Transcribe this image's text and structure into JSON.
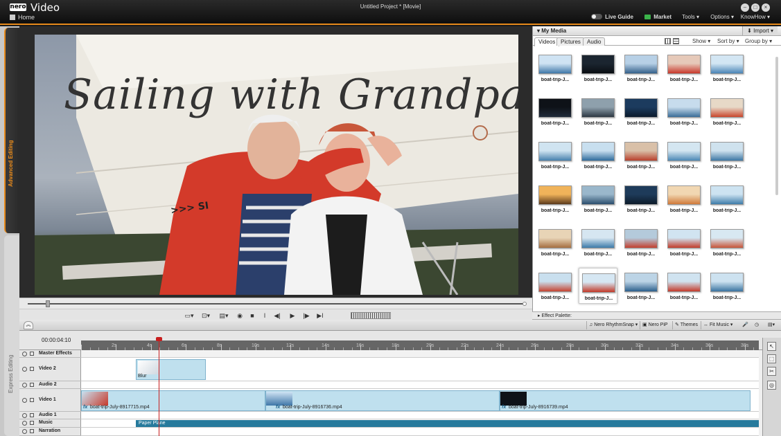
{
  "app": {
    "logo": "nero",
    "name": "Video",
    "window_title": "Untitled Project * [Movie]",
    "home": "Home"
  },
  "menu": {
    "live_guide": "Live Guide",
    "market": "Market",
    "tools": "Tools ▾",
    "options": "Options ▾",
    "knowhow": "KnowHow ▾"
  },
  "side_tabs": {
    "advanced": "Advanced Editing",
    "express": "Express Editing"
  },
  "preview": {
    "title_overlay": "Sailing with Grandpa",
    "sail_text": ">>> SI"
  },
  "media": {
    "header": "▾ My Media",
    "import": "⬇ Import ▾",
    "tabs": [
      "Videos",
      "Pictures",
      "Audio"
    ],
    "show": "Show ▾",
    "sort_by": "Sort by ▾",
    "group_by": "Group by ▾",
    "thumb_label": "boat-trip-J...",
    "thumbs": [
      {
        "c1": "#cfe3f3",
        "c2": "#3f77a8"
      },
      {
        "c1": "#1b2530",
        "c2": "#0a0e12"
      },
      {
        "c1": "#b7d0e6",
        "c2": "#34608a"
      },
      {
        "c1": "#e6c9b9",
        "c2": "#c8382b"
      },
      {
        "c1": "#d3e6f3",
        "c2": "#4a84b6"
      },
      {
        "c1": "#0e1218",
        "c2": "#1f2a3a"
      },
      {
        "c1": "#8ea0ac",
        "c2": "#2d3842"
      },
      {
        "c1": "#1c3b5e",
        "c2": "#0b1a2c"
      },
      {
        "c1": "#c7dced",
        "c2": "#3a6d98"
      },
      {
        "c1": "#e7d9c7",
        "c2": "#c9462c"
      },
      {
        "c1": "#d0e4f1",
        "c2": "#4780ad"
      },
      {
        "c1": "#c8dfef",
        "c2": "#2f6b9c"
      },
      {
        "c1": "#d9c0a8",
        "c2": "#b8402c"
      },
      {
        "c1": "#d4e6f1",
        "c2": "#4c88b5"
      },
      {
        "c1": "#cfe2ee",
        "c2": "#3d77a4"
      },
      {
        "c1": "#f0b35a",
        "c2": "#5b3a1c"
      },
      {
        "c1": "#9ab7cb",
        "c2": "#2b4e6d"
      },
      {
        "c1": "#1e3b5a",
        "c2": "#0d1b2a"
      },
      {
        "c1": "#f1d7b2",
        "c2": "#d07a3a"
      },
      {
        "c1": "#cde3f1",
        "c2": "#3e7caa"
      },
      {
        "c1": "#e8d4b6",
        "c2": "#a56e40"
      },
      {
        "c1": "#d6e6f1",
        "c2": "#3c7aa9"
      },
      {
        "c1": "#b4cadb",
        "c2": "#c33f2e"
      },
      {
        "c1": "#d1e4f1",
        "c2": "#c33c2a"
      },
      {
        "c1": "#d8e8f2",
        "c2": "#c75539"
      },
      {
        "c1": "#c9dfee",
        "c2": "#c64432"
      },
      {
        "c1": "#d6e7f3",
        "c2": "#c23a29"
      },
      {
        "c1": "#bcd4e6",
        "c2": "#2c5f8c"
      },
      {
        "c1": "#d0e3f0",
        "c2": "#c43a2b"
      },
      {
        "c1": "#cde2f0",
        "c2": "#3a73a0"
      }
    ],
    "selected_index": 26
  },
  "effect_palette": "▸ Effect Palette:",
  "tl_toolbar": {
    "rhythmsnap": "Nero RhythmSnap ▾",
    "pip": "Nero PiP",
    "themes": "Themes",
    "fit_music": "Fit Music ▾"
  },
  "timeline": {
    "timecode": "00:00:04:10",
    "ruler_labels": [
      "2s",
      "4s",
      "6s",
      "8s",
      "10s",
      "12s",
      "14s",
      "16s",
      "18s",
      "20s",
      "22s",
      "24s",
      "26s",
      "28s",
      "30s",
      "32s",
      "34s",
      "36s",
      "38s"
    ],
    "tracks": {
      "master_effects": "Master Effects",
      "video2": "Video 2",
      "audio2": "Audio 2",
      "video1": "Video 1",
      "audio1": "Audio 1",
      "music": "Music",
      "narration": "Narration"
    },
    "blur_clip": "Blur",
    "clip1": "boat-trip-July-8917715.mp4",
    "clip2": "boat-trip-July-8916736.mp4",
    "clip3": "boat-trip-July-8916739.mp4",
    "fx": "fx",
    "music_clip": "Paper Plane"
  },
  "colors": {
    "accent": "#e88a1a",
    "clip": "#bfe0ee",
    "music": "#267a9c",
    "playhead": "#c81e1e"
  }
}
